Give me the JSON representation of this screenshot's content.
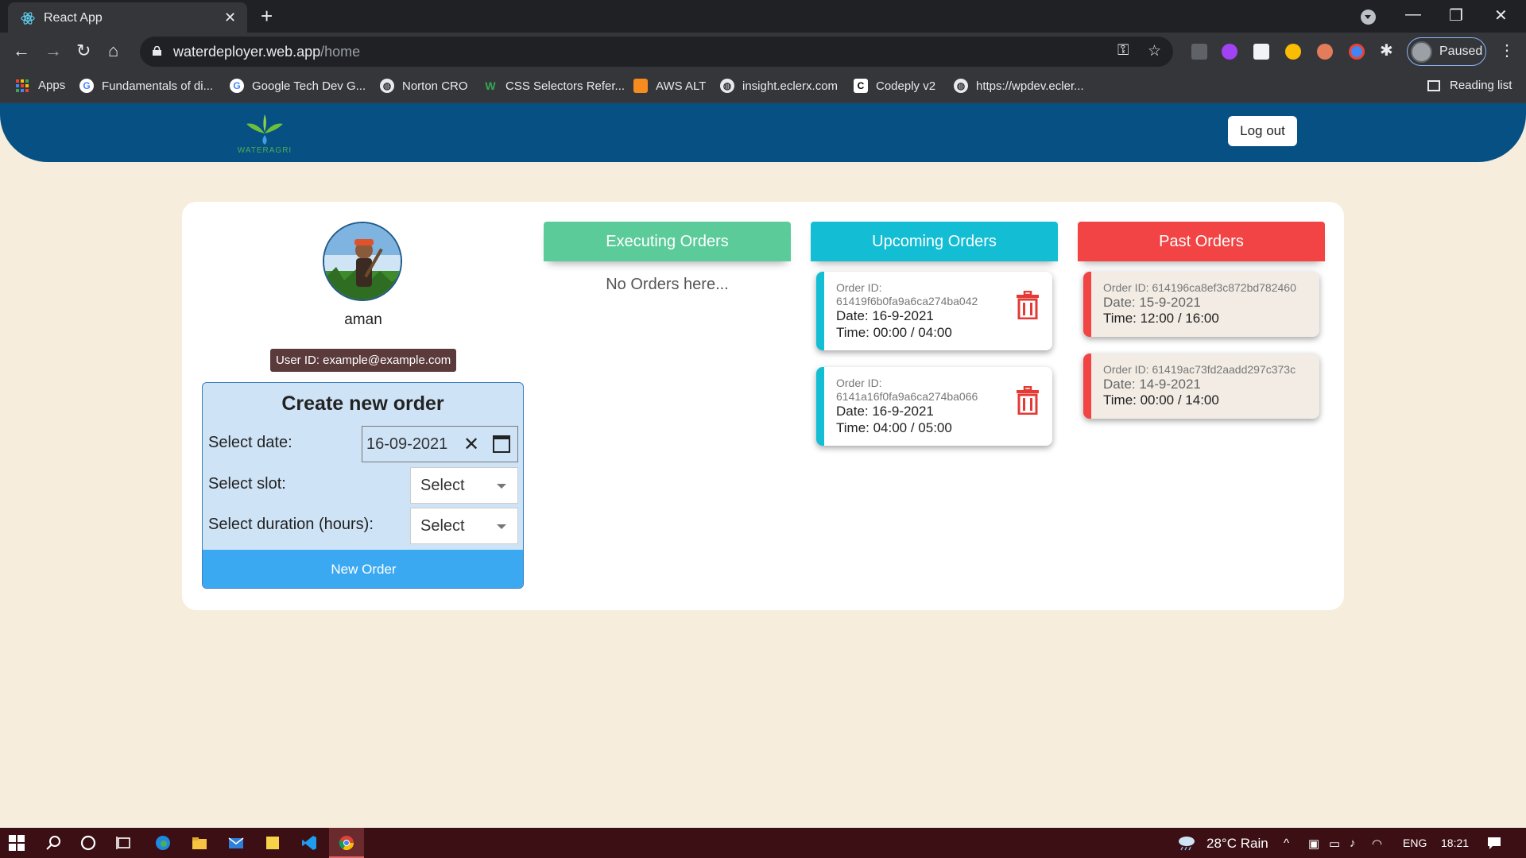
{
  "browser": {
    "tab_title": "React App",
    "tab_close": "✕",
    "new_tab": "+",
    "url_host": "waterdeployer.web.app",
    "url_path": "/home",
    "profile_label": "Paused",
    "window_controls": {
      "minimize": "—",
      "restore": "❐",
      "close": "✕"
    }
  },
  "bookmarks": {
    "apps": "Apps",
    "items": [
      "Fundamentals of di...",
      "Google Tech Dev G...",
      "Norton CRO",
      "CSS Selectors Refer...",
      "AWS ALT",
      "insight.eclerx.com",
      "Codeply v2",
      "https://wpdev.ecler..."
    ],
    "reading_list": "Reading list"
  },
  "header": {
    "logo_text": "WATERAGRI",
    "logout_label": "Log out"
  },
  "profile": {
    "name": "aman",
    "user_id": "User ID: example@example.com"
  },
  "form": {
    "title": "Create new order",
    "date_label": "Select date:",
    "date_value": "16-09-2021",
    "slot_label": "Select slot:",
    "slot_value": "Select",
    "duration_label": "Select duration (hours):",
    "duration_value": "Select",
    "submit_label": "New Order"
  },
  "columns": {
    "executing": {
      "title": "Executing Orders",
      "color": "#5ccb9a",
      "empty_text": "No Orders here..."
    },
    "upcoming": {
      "title": "Upcoming Orders",
      "color": "#13bdd4",
      "orders": [
        {
          "id_label": "Order ID:",
          "id": "61419f6b0fa9a6ca274ba042",
          "date": "Date: 16-9-2021",
          "time": "Time: 00:00 / 04:00"
        },
        {
          "id_label": "Order ID:",
          "id": "6141a16f0fa9a6ca274ba066",
          "date": "Date: 16-9-2021",
          "time": "Time: 04:00 / 05:00"
        }
      ]
    },
    "past": {
      "title": "Past Orders",
      "color": "#f24444",
      "orders": [
        {
          "id": "Order ID: 614196ca8ef3c872bd782460",
          "date": "Date: 15-9-2021",
          "time": "Time: 12:00 / 16:00"
        },
        {
          "id": "Order ID: 61419ac73fd2aadd297c373c",
          "date": "Date: 14-9-2021",
          "time": "Time: 00:00 / 14:00"
        }
      ]
    }
  },
  "taskbar": {
    "weather": "28°C Rain",
    "language": "ENG",
    "clock": "18:21"
  }
}
